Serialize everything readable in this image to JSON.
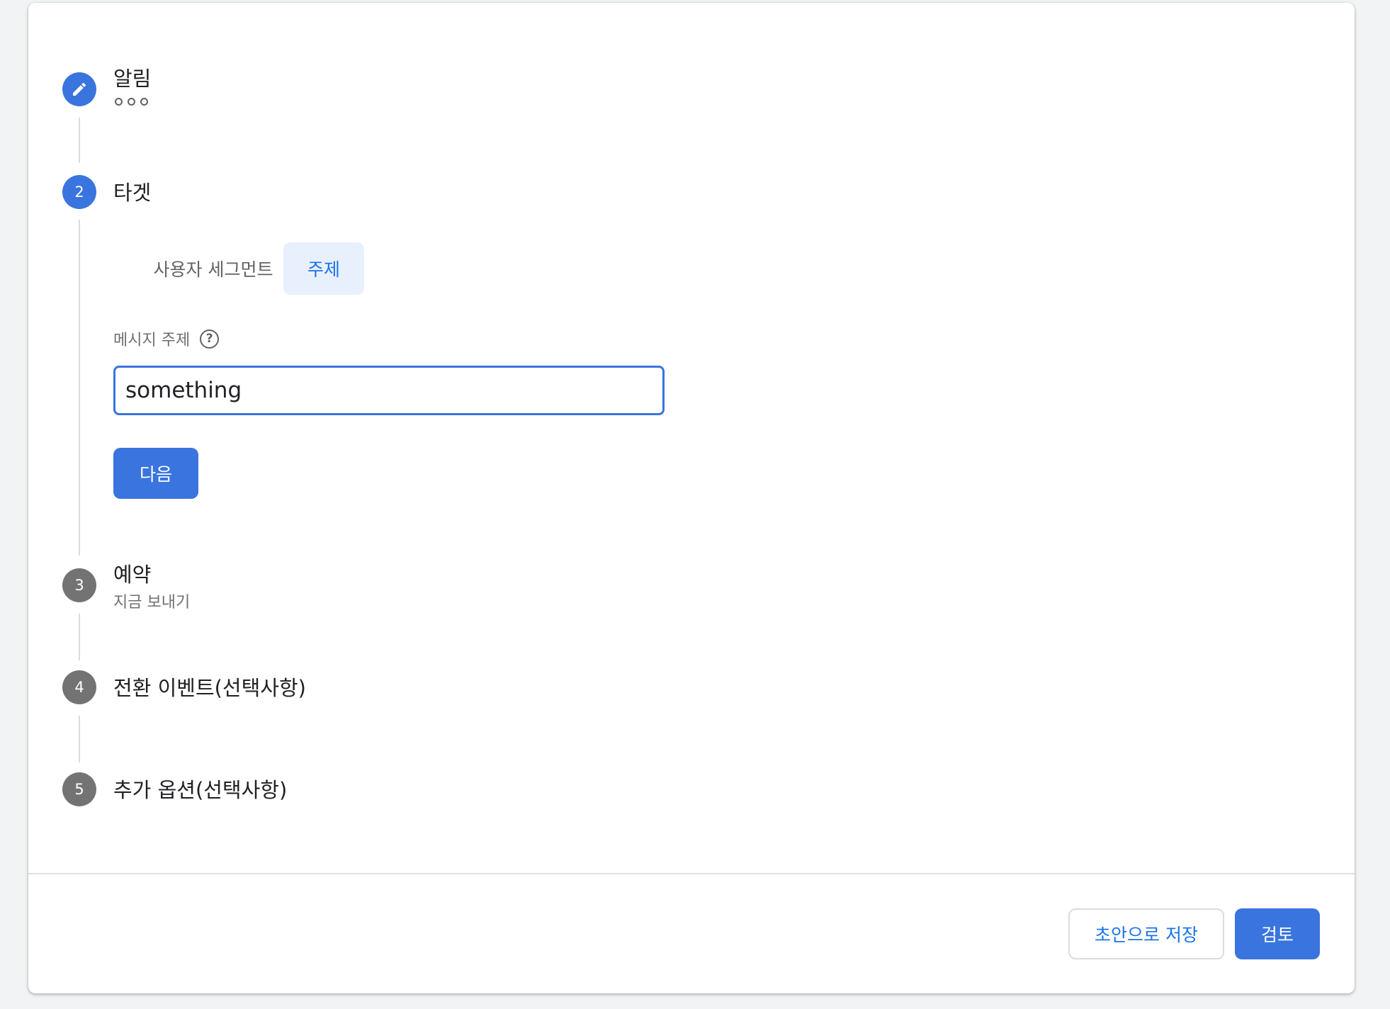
{
  "steps": [
    {
      "number": "",
      "icon": "pencil-icon",
      "title": "알림",
      "state": "editing"
    },
    {
      "number": "2",
      "title": "타겟",
      "state": "active"
    },
    {
      "number": "3",
      "title": "예약",
      "subtitle": "지금 보내기",
      "state": "inactive"
    },
    {
      "number": "4",
      "title": "전환 이벤트(선택사항)",
      "state": "inactive"
    },
    {
      "number": "5",
      "title": "추가 옵션(선택사항)",
      "state": "inactive"
    }
  ],
  "target": {
    "tabs": [
      {
        "label": "사용자 세그먼트",
        "selected": false
      },
      {
        "label": "주제",
        "selected": true
      }
    ],
    "field_label": "메시지 주제",
    "help_icon": "help-circle-icon",
    "input_value": "something",
    "next_label": "다음"
  },
  "footer": {
    "save_draft_label": "초안으로 저장",
    "review_label": "검토"
  },
  "colors": {
    "accent": "#3a74de",
    "selected_tab_bg": "#e8f0fe",
    "inactive_step": "#737373"
  }
}
